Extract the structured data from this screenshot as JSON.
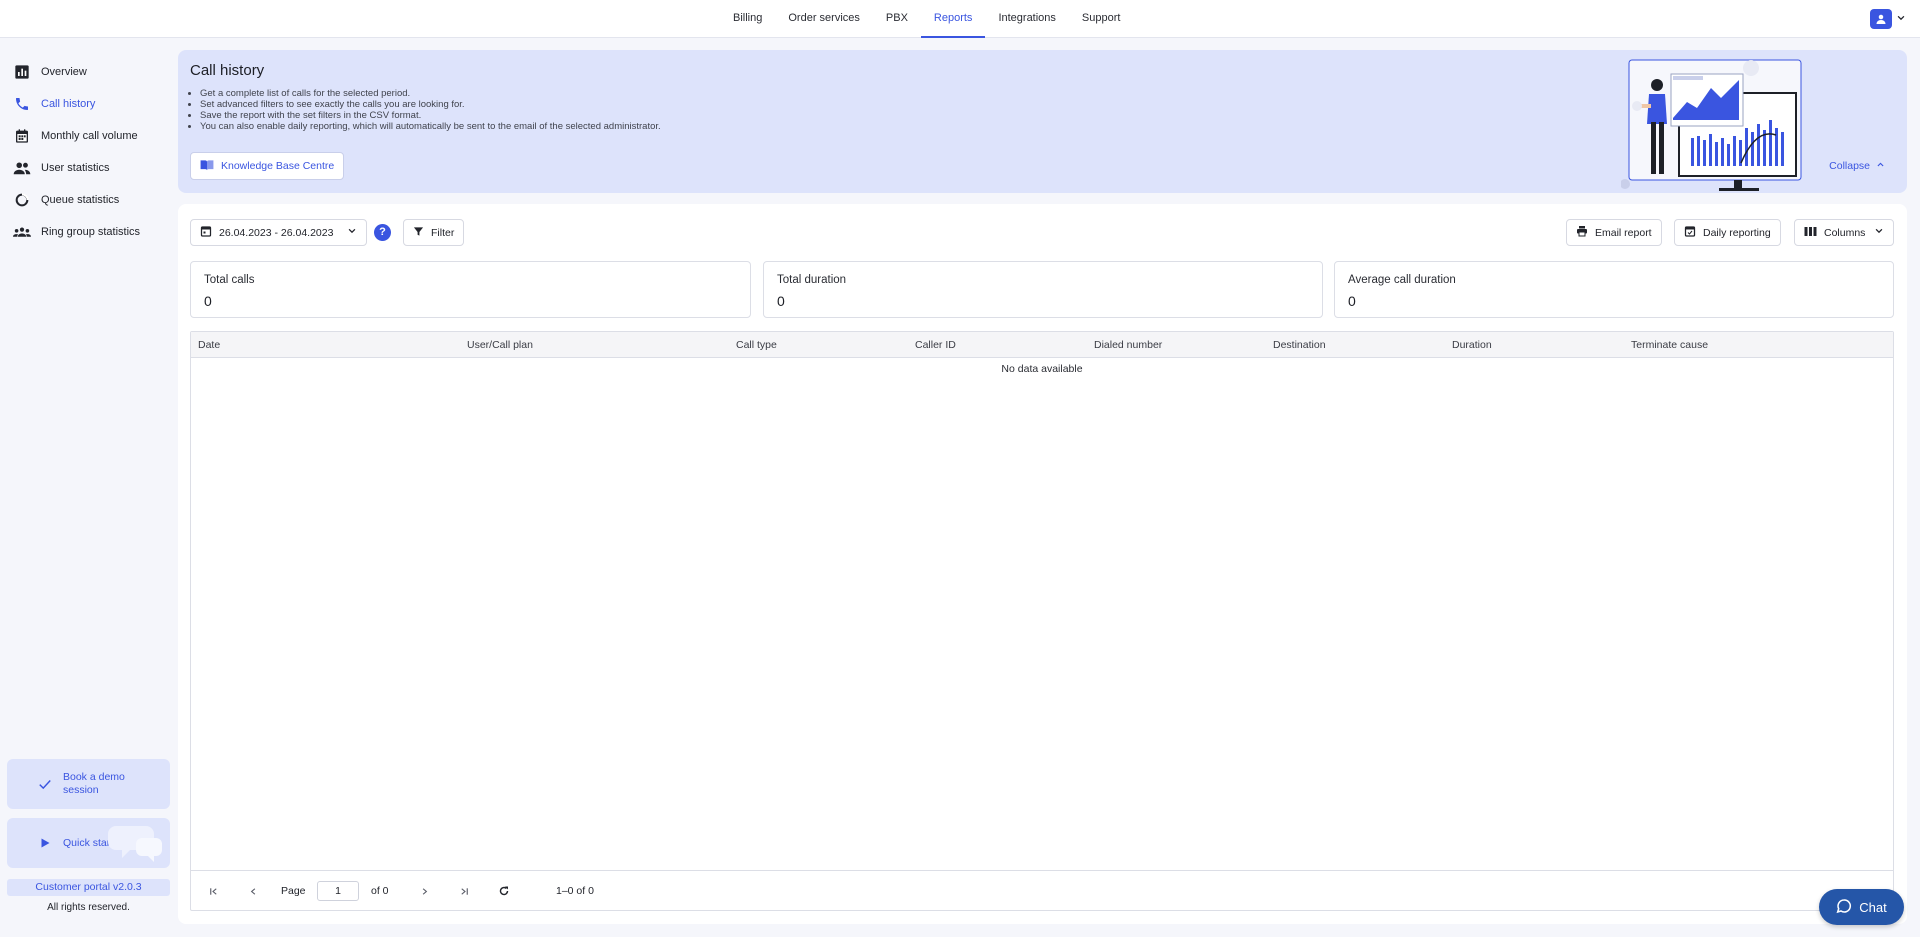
{
  "topnav": {
    "items": [
      "Billing",
      "Order services",
      "PBX",
      "Reports",
      "Integrations",
      "Support"
    ],
    "active": "Reports"
  },
  "sidebar": {
    "items": [
      {
        "label": "Overview",
        "icon": "bar-chart-icon"
      },
      {
        "label": "Call history",
        "icon": "phone-icon"
      },
      {
        "label": "Monthly call volume",
        "icon": "calendar-icon"
      },
      {
        "label": "User statistics",
        "icon": "users-icon"
      },
      {
        "label": "Queue statistics",
        "icon": "donut-icon"
      },
      {
        "label": "Ring group statistics",
        "icon": "group-icon"
      }
    ],
    "active": "Call history",
    "promo_demo": "Book a demo session",
    "promo_guide": "Quick start guide",
    "version": "Customer portal v2.0.3",
    "rights": "All rights reserved."
  },
  "banner": {
    "title": "Call history",
    "bullets": [
      "Get a complete list of calls for the selected period.",
      "Set advanced filters to see exactly the calls you are looking for.",
      "Save the report with the set filters in the CSV format.",
      "You can also enable daily reporting, which will automatically be sent to the email of the selected administrator."
    ],
    "kb_button": "Knowledge Base Centre",
    "collapse": "Collapse"
  },
  "toolbar": {
    "date_range": "26.04.2023 - 26.04.2023",
    "help": "?",
    "filter": "Filter",
    "email_report": "Email report",
    "daily_reporting": "Daily reporting",
    "columns": "Columns"
  },
  "stats": [
    {
      "label": "Total calls",
      "value": "0"
    },
    {
      "label": "Total duration",
      "value": "0"
    },
    {
      "label": "Average call duration",
      "value": "0"
    }
  ],
  "table": {
    "columns": [
      "Date",
      "User/Call plan",
      "Call type",
      "Caller ID",
      "Dialed number",
      "Destination",
      "Duration",
      "Terminate cause"
    ],
    "empty_text": "No data available"
  },
  "pager": {
    "page_label": "Page",
    "page_value": "1",
    "of_label": "of 0",
    "range": "1–0 of 0"
  },
  "chat": {
    "label": "Chat"
  },
  "colors": {
    "accent": "#3a55e0",
    "banner": "#dde3fb",
    "chat": "#2556a8"
  }
}
